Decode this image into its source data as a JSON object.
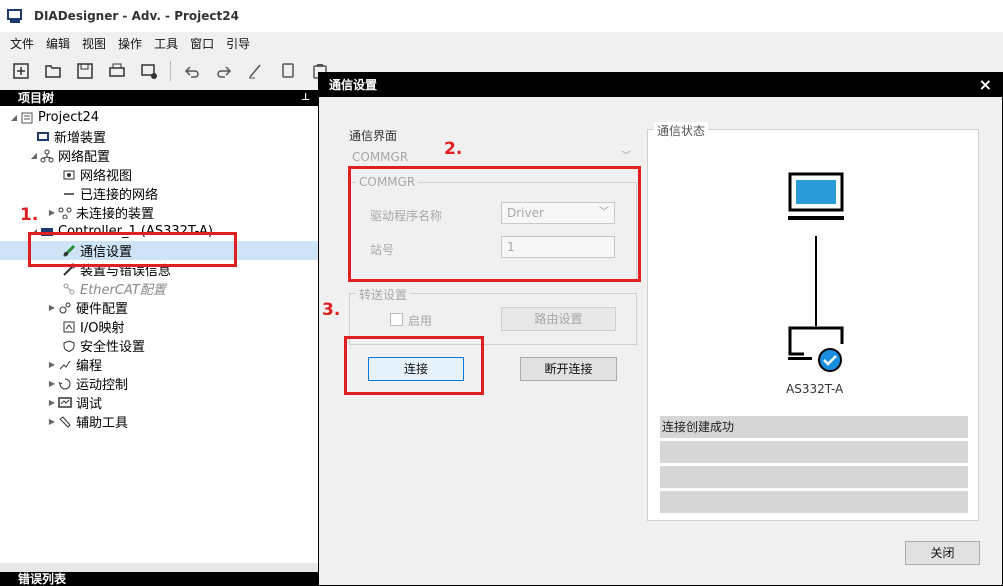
{
  "app": {
    "title": "DIADesigner  - Adv. - Project24"
  },
  "menu": [
    "文件",
    "编辑",
    "视图",
    "操作",
    "工具",
    "窗口",
    "引导"
  ],
  "toolbar": {
    "icons": [
      "new-icon",
      "open-icon",
      "save-icon",
      "print-icon",
      "device-icon",
      "undo-icon",
      "redo-icon",
      "edit-icon",
      "copy-icon",
      "paste-icon"
    ]
  },
  "tree": {
    "header": "项目树",
    "pin": "⊥",
    "items": [
      {
        "label": "Project24"
      },
      {
        "label": "新增装置"
      },
      {
        "label": "网络配置"
      },
      {
        "label": "网络视图"
      },
      {
        "label": "已连接的网络"
      },
      {
        "label": "未连接的装置"
      },
      {
        "label": "Controller_1 (AS332T-A)"
      },
      {
        "label": "通信设置"
      },
      {
        "label": "装置与错误信息"
      },
      {
        "label": "EtherCAT配置"
      },
      {
        "label": "硬件配置"
      },
      {
        "label": "I/O映射"
      },
      {
        "label": "安全性设置"
      },
      {
        "label": "编程"
      },
      {
        "label": "运动控制"
      },
      {
        "label": "调试"
      },
      {
        "label": "辅助工具"
      }
    ]
  },
  "error_list": {
    "label": "错误列表"
  },
  "annotations": [
    "1.",
    "2.",
    "3."
  ],
  "dialog": {
    "title": "通信设置",
    "close": "×",
    "interface_label": "通信界面",
    "interface_value": "COMMGR",
    "commgr_group": "COMMGR",
    "driver_label": "驱动程序名称",
    "driver_value": "Driver",
    "station_label": "站号",
    "station_value": "1",
    "forward_group": "转送设置",
    "enable_label": "启用",
    "route_button": "路由设置",
    "connect_button": "连接",
    "disconnect_button": "断开连接",
    "status_group": "通信状态",
    "device_name": "AS332T-A",
    "status_rows": [
      "连接创建成功",
      "",
      "",
      ""
    ],
    "close_button": "关闭"
  },
  "colors": {
    "annotation": "#e02020",
    "pc": "#2b9ad8",
    "check": "#1a8fe0"
  }
}
